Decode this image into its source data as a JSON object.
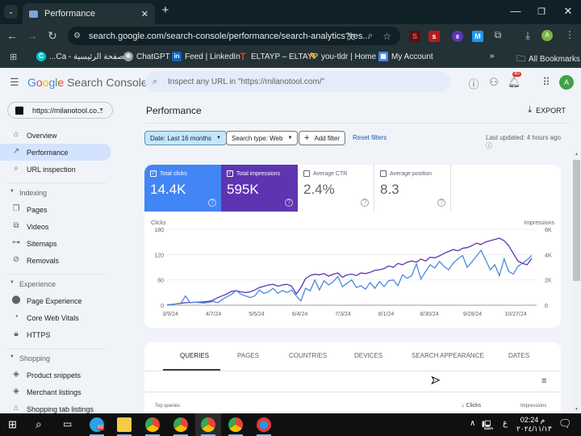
{
  "browser": {
    "tab_title": "Performance",
    "new_tab_icon": "plus-icon",
    "url": "search.google.com/search-console/performance/search-analytics?res...",
    "window_controls": [
      "minimize",
      "restore",
      "close"
    ],
    "profile_initial": "A",
    "extension_badge": "8"
  },
  "bookmarks": {
    "items": [
      {
        "label": "الصفحة الرئيسية - Ca...",
        "icon": "canva-icon",
        "color": "#00c4cc"
      },
      {
        "label": "ChatGPT",
        "icon": "chatgpt-icon",
        "color": "#9aa0a6"
      },
      {
        "label": "Feed | LinkedIn",
        "icon": "linkedin-icon",
        "color": "#0a66c2"
      },
      {
        "label": "ELTAYP – ELTAYP",
        "icon": "eltayp-icon",
        "color": "#e53935"
      },
      {
        "label": "you-tldr | Home",
        "icon": "pencil-icon",
        "color": "#f9a825"
      },
      {
        "label": "My Account",
        "icon": "grid-icon",
        "color": "#4285f4"
      }
    ],
    "more": "»",
    "all_bookmarks": "All Bookmarks"
  },
  "gsc": {
    "product_google": "Google",
    "product_name": "Search Console",
    "search_placeholder": "Inspect any URL in \"https://milanotool.com/\"",
    "notification_count": "40",
    "avatar_initial": "A",
    "property": "https://milanotool.co..."
  },
  "sidebar": {
    "top_items": [
      {
        "label": "Overview",
        "icon": "home-icon"
      },
      {
        "label": "Performance",
        "icon": "trending-up-icon",
        "active": true
      },
      {
        "label": "URL inspection",
        "icon": "search-icon"
      }
    ],
    "sections": [
      {
        "title": "Indexing",
        "items": [
          {
            "label": "Pages",
            "icon": "pages-icon"
          },
          {
            "label": "Videos",
            "icon": "video-icon"
          },
          {
            "label": "Sitemaps",
            "icon": "sitemap-icon"
          },
          {
            "label": "Removals",
            "icon": "eye-off-icon"
          }
        ]
      },
      {
        "title": "Experience",
        "items": [
          {
            "label": "Page Experience",
            "icon": "page-experience-icon"
          },
          {
            "label": "Core Web Vitals",
            "icon": "gauge-icon"
          },
          {
            "label": "HTTPS",
            "icon": "lock-icon"
          }
        ]
      },
      {
        "title": "Shopping",
        "items": [
          {
            "label": "Product snippets",
            "icon": "diamond-icon"
          },
          {
            "label": "Merchant listings",
            "icon": "diamond-icon"
          },
          {
            "label": "Shopping tab listings",
            "icon": "tag-icon"
          }
        ]
      }
    ]
  },
  "main": {
    "title": "Performance",
    "export_label": "EXPORT",
    "filters": {
      "date": "Date: Last 16 months",
      "search_type": "Search type: Web",
      "add_filter": "Add filter",
      "reset": "Reset filters"
    },
    "last_updated": "Last updated: 4 hours ago",
    "metrics": [
      {
        "label": "Total clicks",
        "value": "14.4K",
        "checked": true,
        "color": "#4285f4"
      },
      {
        "label": "Total impressions",
        "value": "595K",
        "checked": true,
        "color": "#5e35b1"
      },
      {
        "label": "Average CTR",
        "value": "2.4%",
        "checked": false,
        "color": "#ffffff"
      },
      {
        "label": "Average position",
        "value": "8.3",
        "checked": false,
        "color": "#ffffff"
      }
    ],
    "tabs": [
      "QUERIES",
      "PAGES",
      "COUNTRIES",
      "DEVICES",
      "SEARCH APPEARANCE",
      "DATES"
    ],
    "active_tab": "QUERIES",
    "table_headers": {
      "query": "Top queries",
      "clicks": "Clicks",
      "impressions": "Impressions"
    }
  },
  "chart_data": {
    "type": "line",
    "title": "",
    "x_ticks": [
      "3/9/24",
      "4/7/24",
      "5/6/24",
      "6/4/24",
      "7/3/24",
      "8/1/24",
      "8/30/24",
      "9/28/24",
      "10/27/24"
    ],
    "left_axis": {
      "label": "Clicks",
      "ticks": [
        0,
        60,
        120,
        180
      ],
      "range": [
        0,
        180
      ]
    },
    "right_axis": {
      "label": "Impressions",
      "ticks": [
        "0",
        "2K",
        "4K",
        "6K"
      ],
      "range": [
        0,
        6000
      ]
    },
    "grid": true,
    "series": [
      {
        "name": "Clicks",
        "axis": "left",
        "color": "#4a89dc",
        "values": [
          1,
          2,
          3,
          5,
          22,
          6,
          7,
          6,
          5,
          7,
          9,
          6,
          14,
          20,
          26,
          35,
          26,
          22,
          18,
          22,
          36,
          28,
          32,
          40,
          28,
          35,
          30,
          36,
          22,
          10,
          40,
          34,
          60,
          36,
          58,
          48,
          56,
          68,
          44,
          52,
          60,
          42,
          46,
          38,
          54,
          40,
          56,
          44,
          58,
          60,
          46,
          72,
          64,
          70,
          98,
          62,
          80,
          96,
          88,
          104,
          92,
          84,
          100,
          110,
          118,
          90,
          102,
          116,
          130,
          108,
          84,
          96,
          70,
          110,
          80,
          74,
          92,
          100,
          108,
          118
        ]
      },
      {
        "name": "Impressions",
        "axis": "right",
        "color": "#5e35b1",
        "values": [
          20,
          60,
          100,
          150,
          200,
          220,
          230,
          250,
          270,
          300,
          400,
          600,
          750,
          900,
          1100,
          1150,
          1050,
          1000,
          1050,
          1200,
          1400,
          1500,
          1600,
          1650,
          1500,
          1600,
          1650,
          1500,
          900,
          1400,
          2100,
          2350,
          2450,
          2400,
          2500,
          2300,
          2450,
          2550,
          2200,
          2400,
          2450,
          2350,
          2550,
          2500,
          2600,
          2750,
          2800,
          2900,
          3100,
          3000,
          3300,
          3200,
          3400,
          3500,
          3400,
          3650,
          3500,
          3800,
          3750,
          3900,
          4100,
          4250,
          4400,
          4300,
          4500,
          4550,
          4700,
          4900,
          4800,
          5000,
          5100,
          5200,
          5300,
          5100,
          4700,
          4100,
          3500,
          3300,
          3200,
          3700
        ]
      }
    ]
  },
  "taskbar": {
    "time": "02:24 م",
    "date": "٢٠٢٤/١١/١٣",
    "lang": "ع",
    "telegram_badge": "69"
  }
}
